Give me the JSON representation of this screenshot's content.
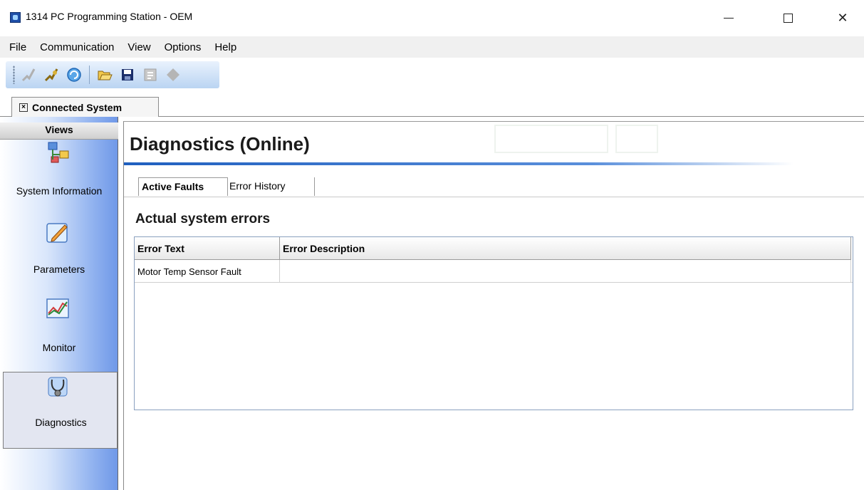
{
  "window": {
    "title": "1314 PC Programming Station - OEM",
    "controls": [
      "minimize",
      "maximize",
      "close"
    ]
  },
  "menu": {
    "items": [
      "File",
      "Communication",
      "View",
      "Options",
      "Help"
    ]
  },
  "toolbar": {
    "buttons": [
      {
        "icon": "disconnect-icon",
        "enabled": false
      },
      {
        "icon": "connect-icon",
        "enabled": true
      },
      {
        "icon": "refresh-icon",
        "enabled": true
      },
      {
        "icon": "open-folder-icon",
        "enabled": true
      },
      {
        "icon": "save-icon",
        "enabled": true
      },
      {
        "icon": "program-icon",
        "enabled": false
      },
      {
        "icon": "stop-icon",
        "enabled": false
      }
    ]
  },
  "document_tab": {
    "label": "Connected System"
  },
  "sidebar": {
    "header": "Views",
    "items": [
      {
        "label": "System Information",
        "icon": "system-information-icon"
      },
      {
        "label": "Parameters",
        "icon": "parameters-icon"
      },
      {
        "label": "Monitor",
        "icon": "monitor-icon"
      },
      {
        "label": "Diagnostics",
        "icon": "diagnostics-icon",
        "active": true
      }
    ]
  },
  "main": {
    "title": "Diagnostics (Online)",
    "tabs": [
      {
        "label": "Active Faults",
        "active": true
      },
      {
        "label": "Error History",
        "active": false
      }
    ],
    "section_title": "Actual system errors",
    "table": {
      "columns": [
        "Error Text",
        "Error Description"
      ],
      "rows": [
        [
          "Motor Temp Sensor Fault",
          ""
        ]
      ]
    }
  },
  "colors": {
    "accent_blue": "#1f5fbf",
    "sidebar_gradient_end": "#6f98e8",
    "toolbar_gradient": "#bad4f2"
  }
}
